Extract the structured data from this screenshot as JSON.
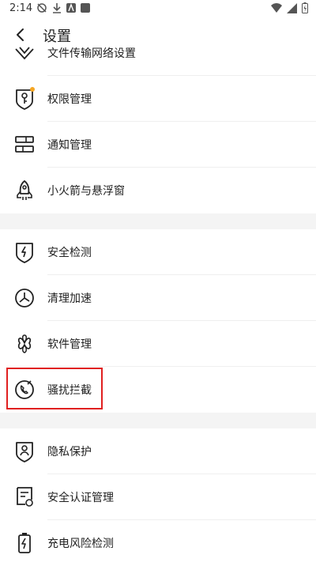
{
  "status_bar": {
    "time": "2:14"
  },
  "header": {
    "title": "设置"
  },
  "groups": [
    {
      "items": [
        {
          "label": "文件传输网络设置",
          "icon": "wifi-transfer-icon"
        },
        {
          "label": "权限管理",
          "icon": "shield-key-icon",
          "badge": true
        },
        {
          "label": "通知管理",
          "icon": "notification-bars-icon"
        },
        {
          "label": "小火箭与悬浮窗",
          "icon": "rocket-icon"
        }
      ]
    },
    {
      "items": [
        {
          "label": "安全检测",
          "icon": "shield-bolt-icon"
        },
        {
          "label": "清理加速",
          "icon": "speed-clean-icon"
        },
        {
          "label": "软件管理",
          "icon": "clover-icon"
        },
        {
          "label": "骚扰拦截",
          "icon": "phone-block-icon"
        }
      ]
    },
    {
      "items": [
        {
          "label": "隐私保护",
          "icon": "privacy-user-icon"
        },
        {
          "label": "安全认证管理",
          "icon": "certificate-icon"
        },
        {
          "label": "充电风险检测",
          "icon": "battery-bolt-icon"
        }
      ]
    }
  ],
  "colors": {
    "badge": "#f5a623",
    "highlight": "#e02020",
    "divider": "#efefef"
  }
}
